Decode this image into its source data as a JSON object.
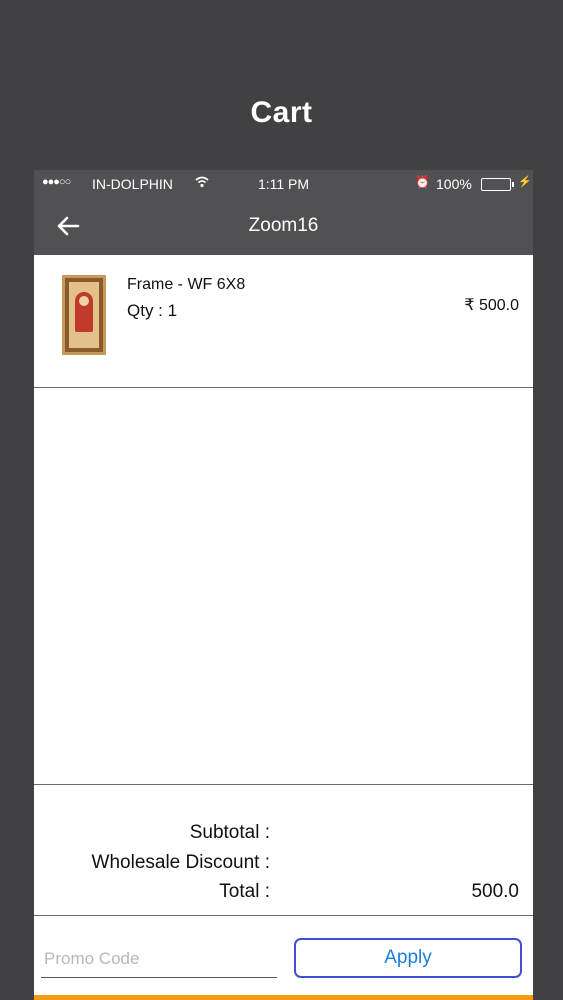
{
  "page_title": "Cart",
  "status_bar": {
    "signal": "●●●○○",
    "carrier": "IN-DOLPHIN",
    "time": "1:11 PM",
    "battery": "100%",
    "battery_level": 1.0
  },
  "nav": {
    "title": "Zoom16"
  },
  "cart_items": [
    {
      "name": "Frame - WF 6X8",
      "qty_label": "Qty : 1",
      "price": "₹ 500.0"
    }
  ],
  "summary": {
    "subtotal_label": "Subtotal :",
    "subtotal_value": "",
    "discount_label": "Wholesale Discount :",
    "discount_value": "",
    "total_label": "Total :",
    "total_value": "500.0"
  },
  "promo": {
    "placeholder": "Promo Code",
    "value": "",
    "apply_label": "Apply"
  },
  "colors": {
    "background": "#414042",
    "navbar": "#515153",
    "apply_border": "#3f4fd6",
    "apply_text": "#1c7fd6",
    "accent_strip": "#f39c12",
    "battery": "#4cd964"
  },
  "icons": {
    "back": "arrow-left-icon",
    "wifi": "wifi-icon",
    "alarm": "alarm-icon",
    "battery": "battery-icon",
    "charging": "charging-bolt-icon"
  }
}
